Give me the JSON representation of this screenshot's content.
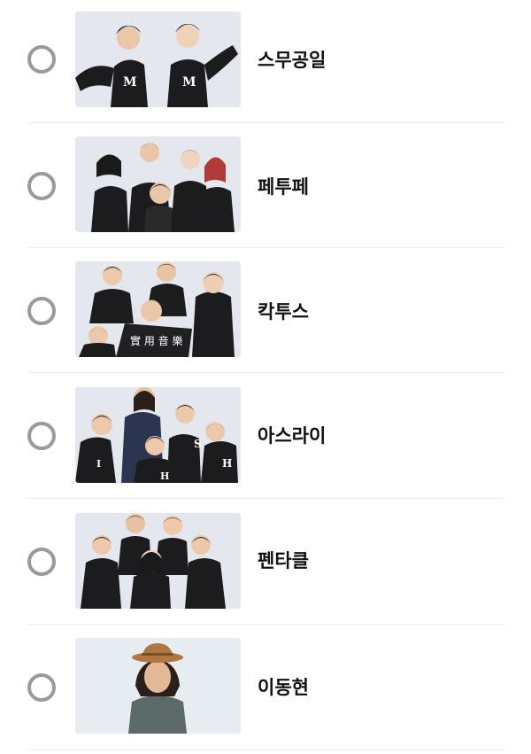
{
  "options": [
    {
      "label": "스무공일",
      "thumb_icon": "group-photo-2-people"
    },
    {
      "label": "페투페",
      "thumb_icon": "group-photo-5-people"
    },
    {
      "label": "칵투스",
      "thumb_icon": "group-photo-6-people-banner"
    },
    {
      "label": "아스라이",
      "thumb_icon": "group-photo-6-people"
    },
    {
      "label": "펜타클",
      "thumb_icon": "group-photo-6-people-dark"
    },
    {
      "label": "이동현",
      "thumb_icon": "solo-photo-with-hat"
    }
  ],
  "colors": {
    "radio_border": "#9a9a9a",
    "divider": "#ececec",
    "thumb_background": "#e4e8ee",
    "jacket": "#1c1c1e",
    "label_text": "#111111"
  }
}
